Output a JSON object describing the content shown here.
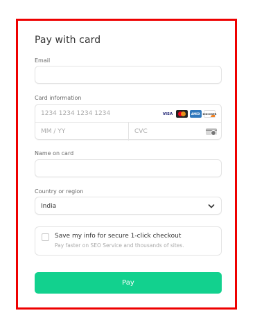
{
  "form": {
    "title": "Pay with card",
    "email": {
      "label": "Email",
      "value": "",
      "placeholder": ""
    },
    "card": {
      "label": "Card information",
      "number_placeholder": "1234 1234 1234 1234",
      "expiry_placeholder": "MM / YY",
      "cvc_placeholder": "CVC",
      "brands": [
        "VISA",
        "mastercard-icon",
        "amex-icon",
        "discover-icon"
      ],
      "visa_text": "VISA",
      "amex_text": "AMEX",
      "discover_text": "DISCOVER"
    },
    "name": {
      "label": "Name on card",
      "value": "",
      "placeholder": ""
    },
    "country": {
      "label": "Country or region",
      "selected": "India"
    },
    "save": {
      "title": "Save my info for secure 1-click checkout",
      "subtitle": "Pay faster on SEO Service and thousands of sites.",
      "checked": false
    },
    "pay_label": "Pay"
  },
  "colors": {
    "frame_border": "#ee0000",
    "pay_button": "#12d18e",
    "field_border": "#e3e3e3"
  }
}
